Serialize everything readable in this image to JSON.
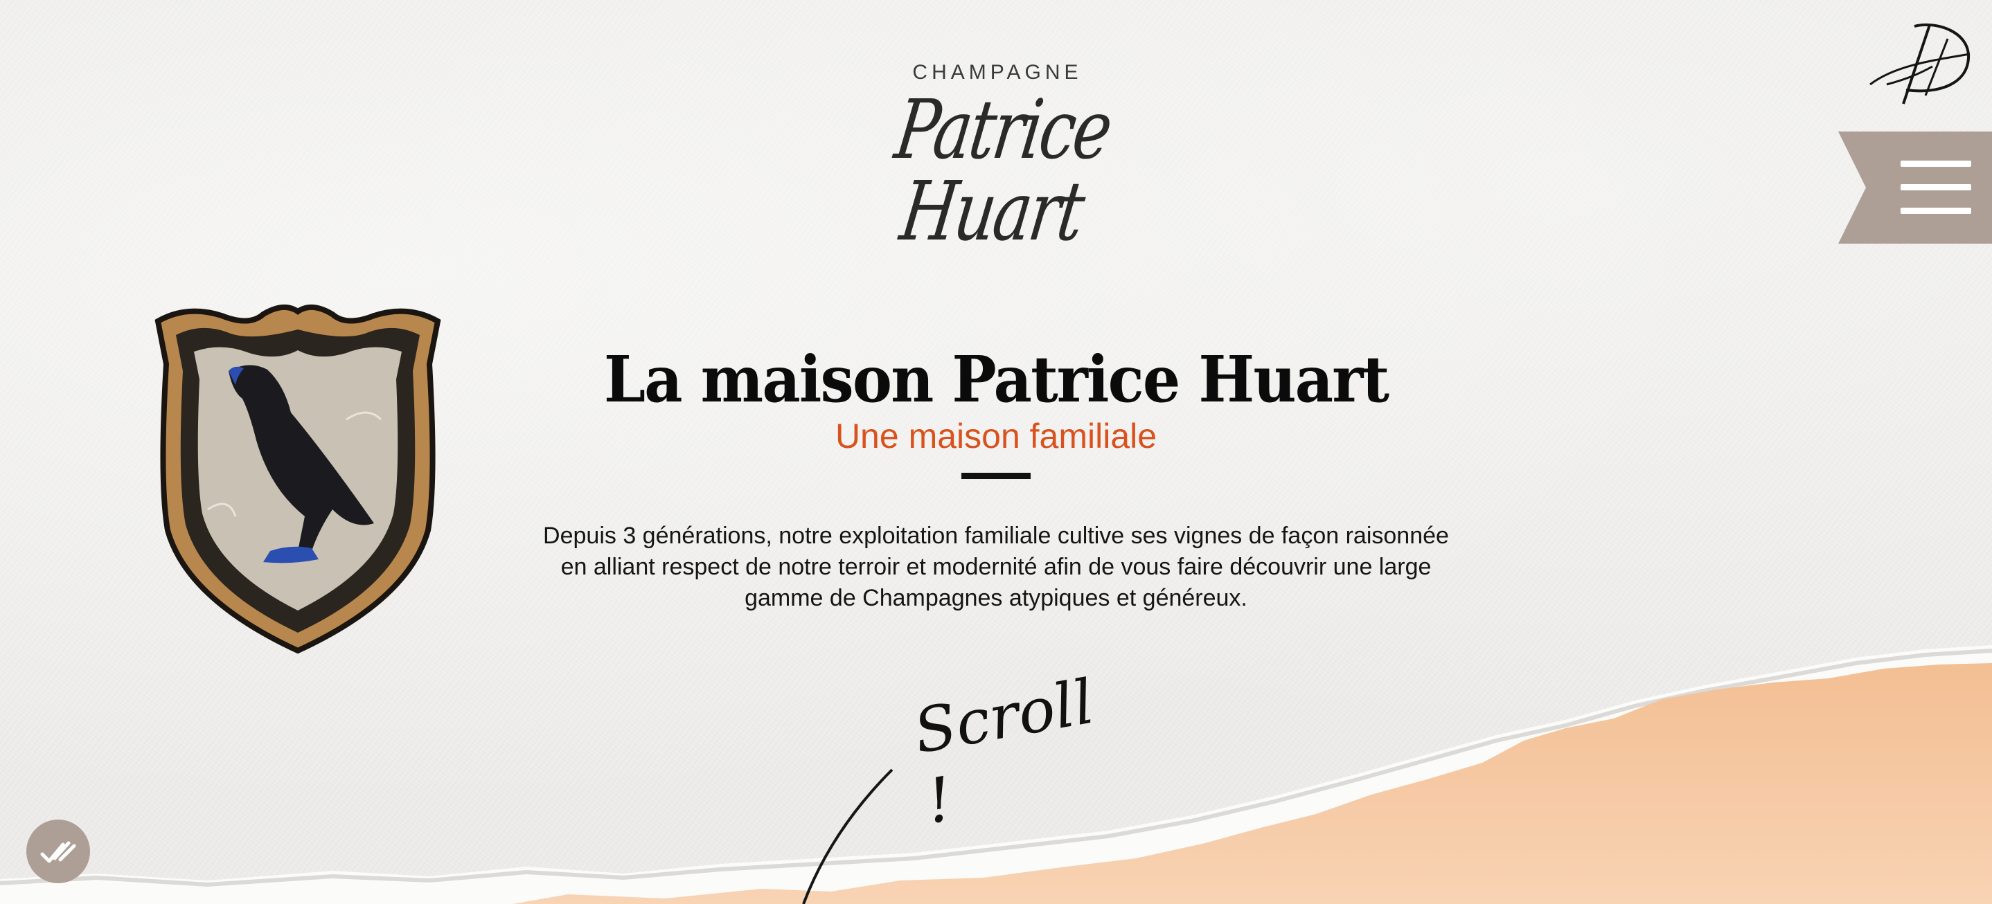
{
  "brand": {
    "top": "CHAMPAGNE",
    "name": "Patrice Huart",
    "monogram": "PH"
  },
  "menu": {
    "icon": "hamburger-icon",
    "color": "#ad9f96"
  },
  "hero": {
    "title": "La maison Patrice Huart",
    "subtitle": "Une maison familiale",
    "lines": [
      "Depuis 3 générations, notre exploitation familiale cultive ses vignes de façon raisonnée",
      "en alliant respect de notre terroir et modernité afin de vous faire découvrir une large",
      "gamme de Champagnes atypiques et généreux."
    ]
  },
  "scroll": {
    "label": "Scroll !"
  },
  "cookie": {
    "icon": "cookie-consent-check-icon"
  },
  "colors": {
    "accent": "#d9521d",
    "tab": "#ad9f96",
    "peach": "#f6c7a0",
    "paper": "#eeedeb"
  }
}
